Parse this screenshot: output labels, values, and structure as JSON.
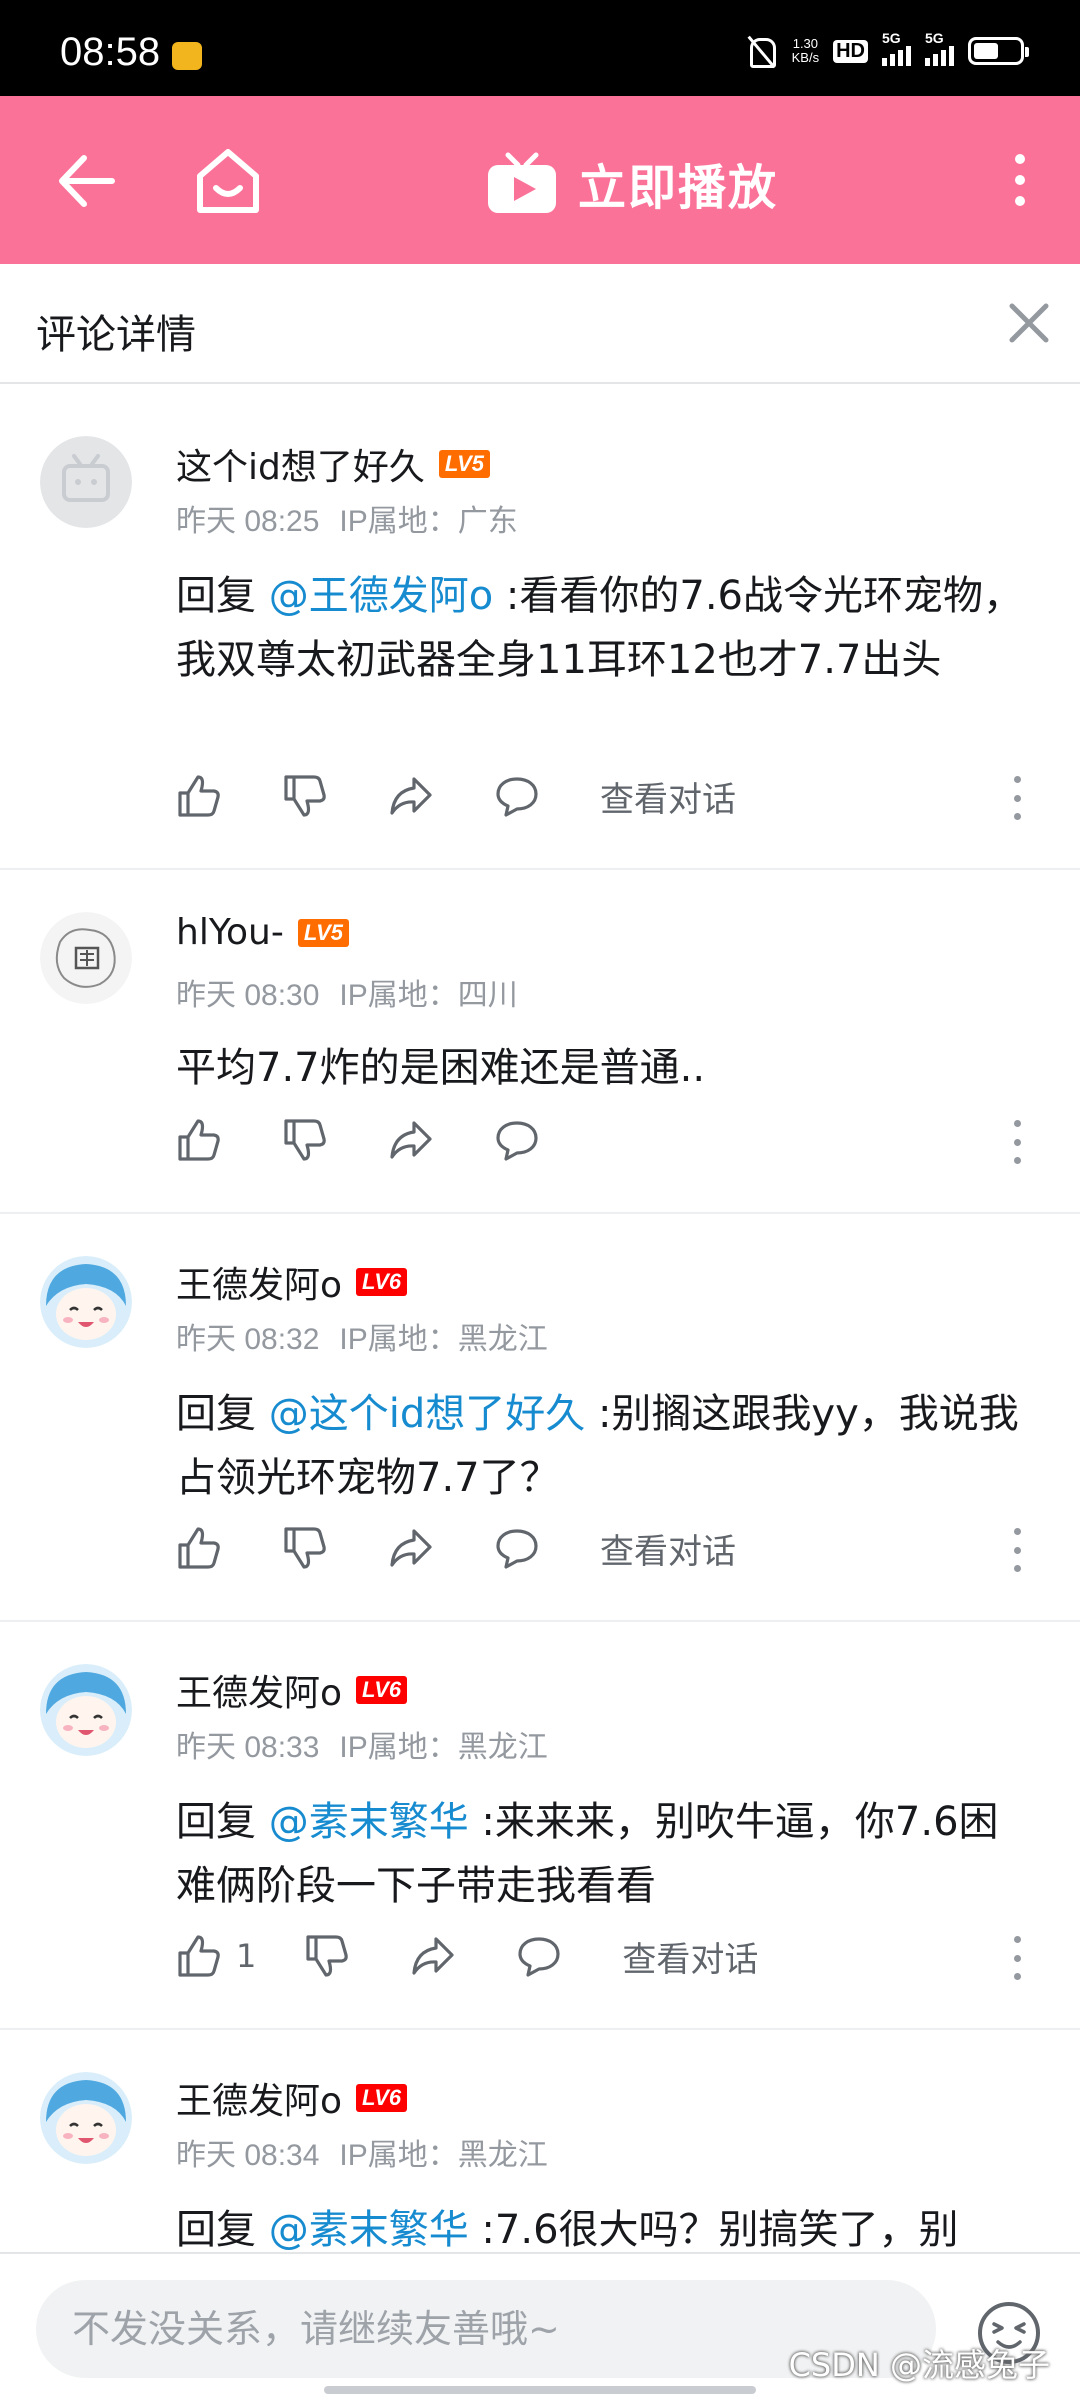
{
  "status_bar": {
    "time": "08:58",
    "net_speed_value": "1.30",
    "net_speed_unit": "KB/s",
    "hd_label": "HD",
    "signal_1": "5G",
    "signal_2": "5G"
  },
  "header": {
    "play_label": "立即播放",
    "bg_color": "#fb7299"
  },
  "panel": {
    "title": "评论详情"
  },
  "comments": [
    {
      "username": "这个id想了好久",
      "level": "LV5",
      "time": "昨天 08:25",
      "ip": "IP属地：广东",
      "reply_prefix": "回复 ",
      "mention": "@王德发阿o",
      "text": " :看看你的7.6战令光环宠物，我双尊太初武器全身11耳环12也才7.7出头",
      "likes": "",
      "view_conversation": "查看对话"
    },
    {
      "username": "hlYou-",
      "level": "LV5",
      "time": "昨天 08:30",
      "ip": "IP属地：四川",
      "reply_prefix": "",
      "mention": "",
      "text": "平均7.7炸的是困难还是普通..",
      "likes": "",
      "view_conversation": ""
    },
    {
      "username": "王德发阿o",
      "level": "LV6",
      "time": "昨天 08:32",
      "ip": "IP属地：黑龙江",
      "reply_prefix": "回复 ",
      "mention": "@这个id想了好久",
      "text": " :别搁这跟我yy，我说我占领光环宠物7.7了？",
      "likes": "",
      "view_conversation": "查看对话"
    },
    {
      "username": "王德发阿o",
      "level": "LV6",
      "time": "昨天 08:33",
      "ip": "IP属地：黑龙江",
      "reply_prefix": "回复 ",
      "mention": "@素末繁华",
      "text": " :来来来，别吹牛逼，你7.6困难俩阶段一下子带走我看看",
      "likes": "1",
      "view_conversation": "查看对话"
    },
    {
      "username": "王德发阿o",
      "level": "LV6",
      "time": "昨天 08:34",
      "ip": "IP属地：黑龙江",
      "reply_prefix": "回复 ",
      "mention": "@素末繁华",
      "text": " :7.6很大吗？别搞笑了，别",
      "likes": "",
      "view_conversation": ""
    }
  ],
  "input": {
    "placeholder": "不发没关系，请继续友善哦~"
  },
  "watermark": "CSDN @流感兔子",
  "colors": {
    "accent_pink": "#fb7299",
    "mention_blue": "#178bcf",
    "lv5": "#ff6c00",
    "lv6": "#ff0000"
  }
}
